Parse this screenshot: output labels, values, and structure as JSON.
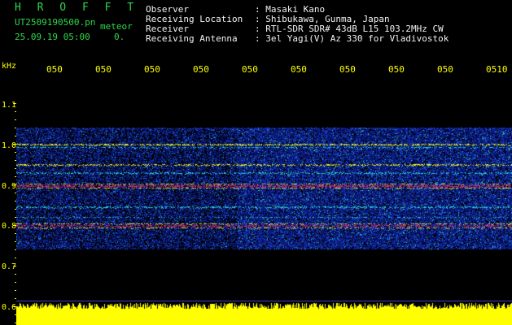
{
  "header": {
    "title": "H R O F F T",
    "file_name": "UT2509190500.pn",
    "file_suffix": "meteor",
    "date_time": "25.09.19 05:00",
    "count": "0.",
    "info": [
      {
        "label": "Observer",
        "value": ": Masaki Kano"
      },
      {
        "label": "Receiving Location",
        "value": ": Shibukawa, Gunma, Japan"
      },
      {
        "label": "Receiver",
        "value": ": RTL-SDR SDR# 43dB L15 103.2MHz CW"
      },
      {
        "label": "Receiving Antenna",
        "value": ": 3el Yagi(V) Az 330 for Vladivostok"
      }
    ]
  },
  "axis": {
    "unit": "kHz",
    "x_ticks": [
      "050",
      "050",
      "050",
      "050",
      "050",
      "050",
      "050",
      "050",
      "050",
      "0510"
    ],
    "y_ticks": [
      "1.1",
      "1.0",
      "0.9",
      "0.8",
      "0.7",
      "0.6"
    ]
  },
  "colors": {
    "background": "#000000",
    "header_title": "#2fd84a",
    "header_text": "#f2f2f2",
    "axis_text": "#ffff00",
    "hum": "#ffff00",
    "noise_blue": "#1a2ba0",
    "band_cyan": "#28c8d8",
    "band_yellow": "#e8f020",
    "band_red": "#ff2060"
  }
}
